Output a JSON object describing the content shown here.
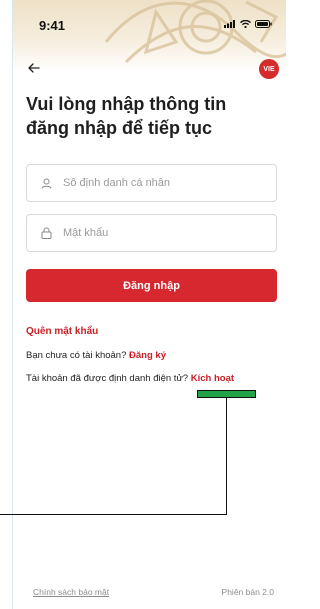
{
  "status_bar": {
    "time": "9:41"
  },
  "header": {
    "lang_badge": "VIE"
  },
  "title": "Vui lòng nhập thông tin\nđăng nhập để tiếp tục",
  "form": {
    "id_placeholder": "Số định danh cá nhân",
    "password_placeholder": "Mật khẩu",
    "login_label": "Đăng nhập"
  },
  "links": {
    "forgot_password": "Quên mật khẩu",
    "no_account_text": "Bạn chưa có tài khoản?",
    "register": "Đăng ký",
    "identified_text": "Tài khoản đã được định danh điện tử?",
    "activate": "Kích hoạt"
  },
  "footer": {
    "privacy_policy": "Chính sách bảo mật",
    "version": "Phiên bản 2.0"
  },
  "colors": {
    "accent": "#d7282f",
    "highlight": "#22a34a"
  },
  "icons": [
    "back-arrow-icon",
    "user-icon",
    "lock-icon",
    "signal-icon",
    "wifi-icon",
    "battery-icon"
  ]
}
